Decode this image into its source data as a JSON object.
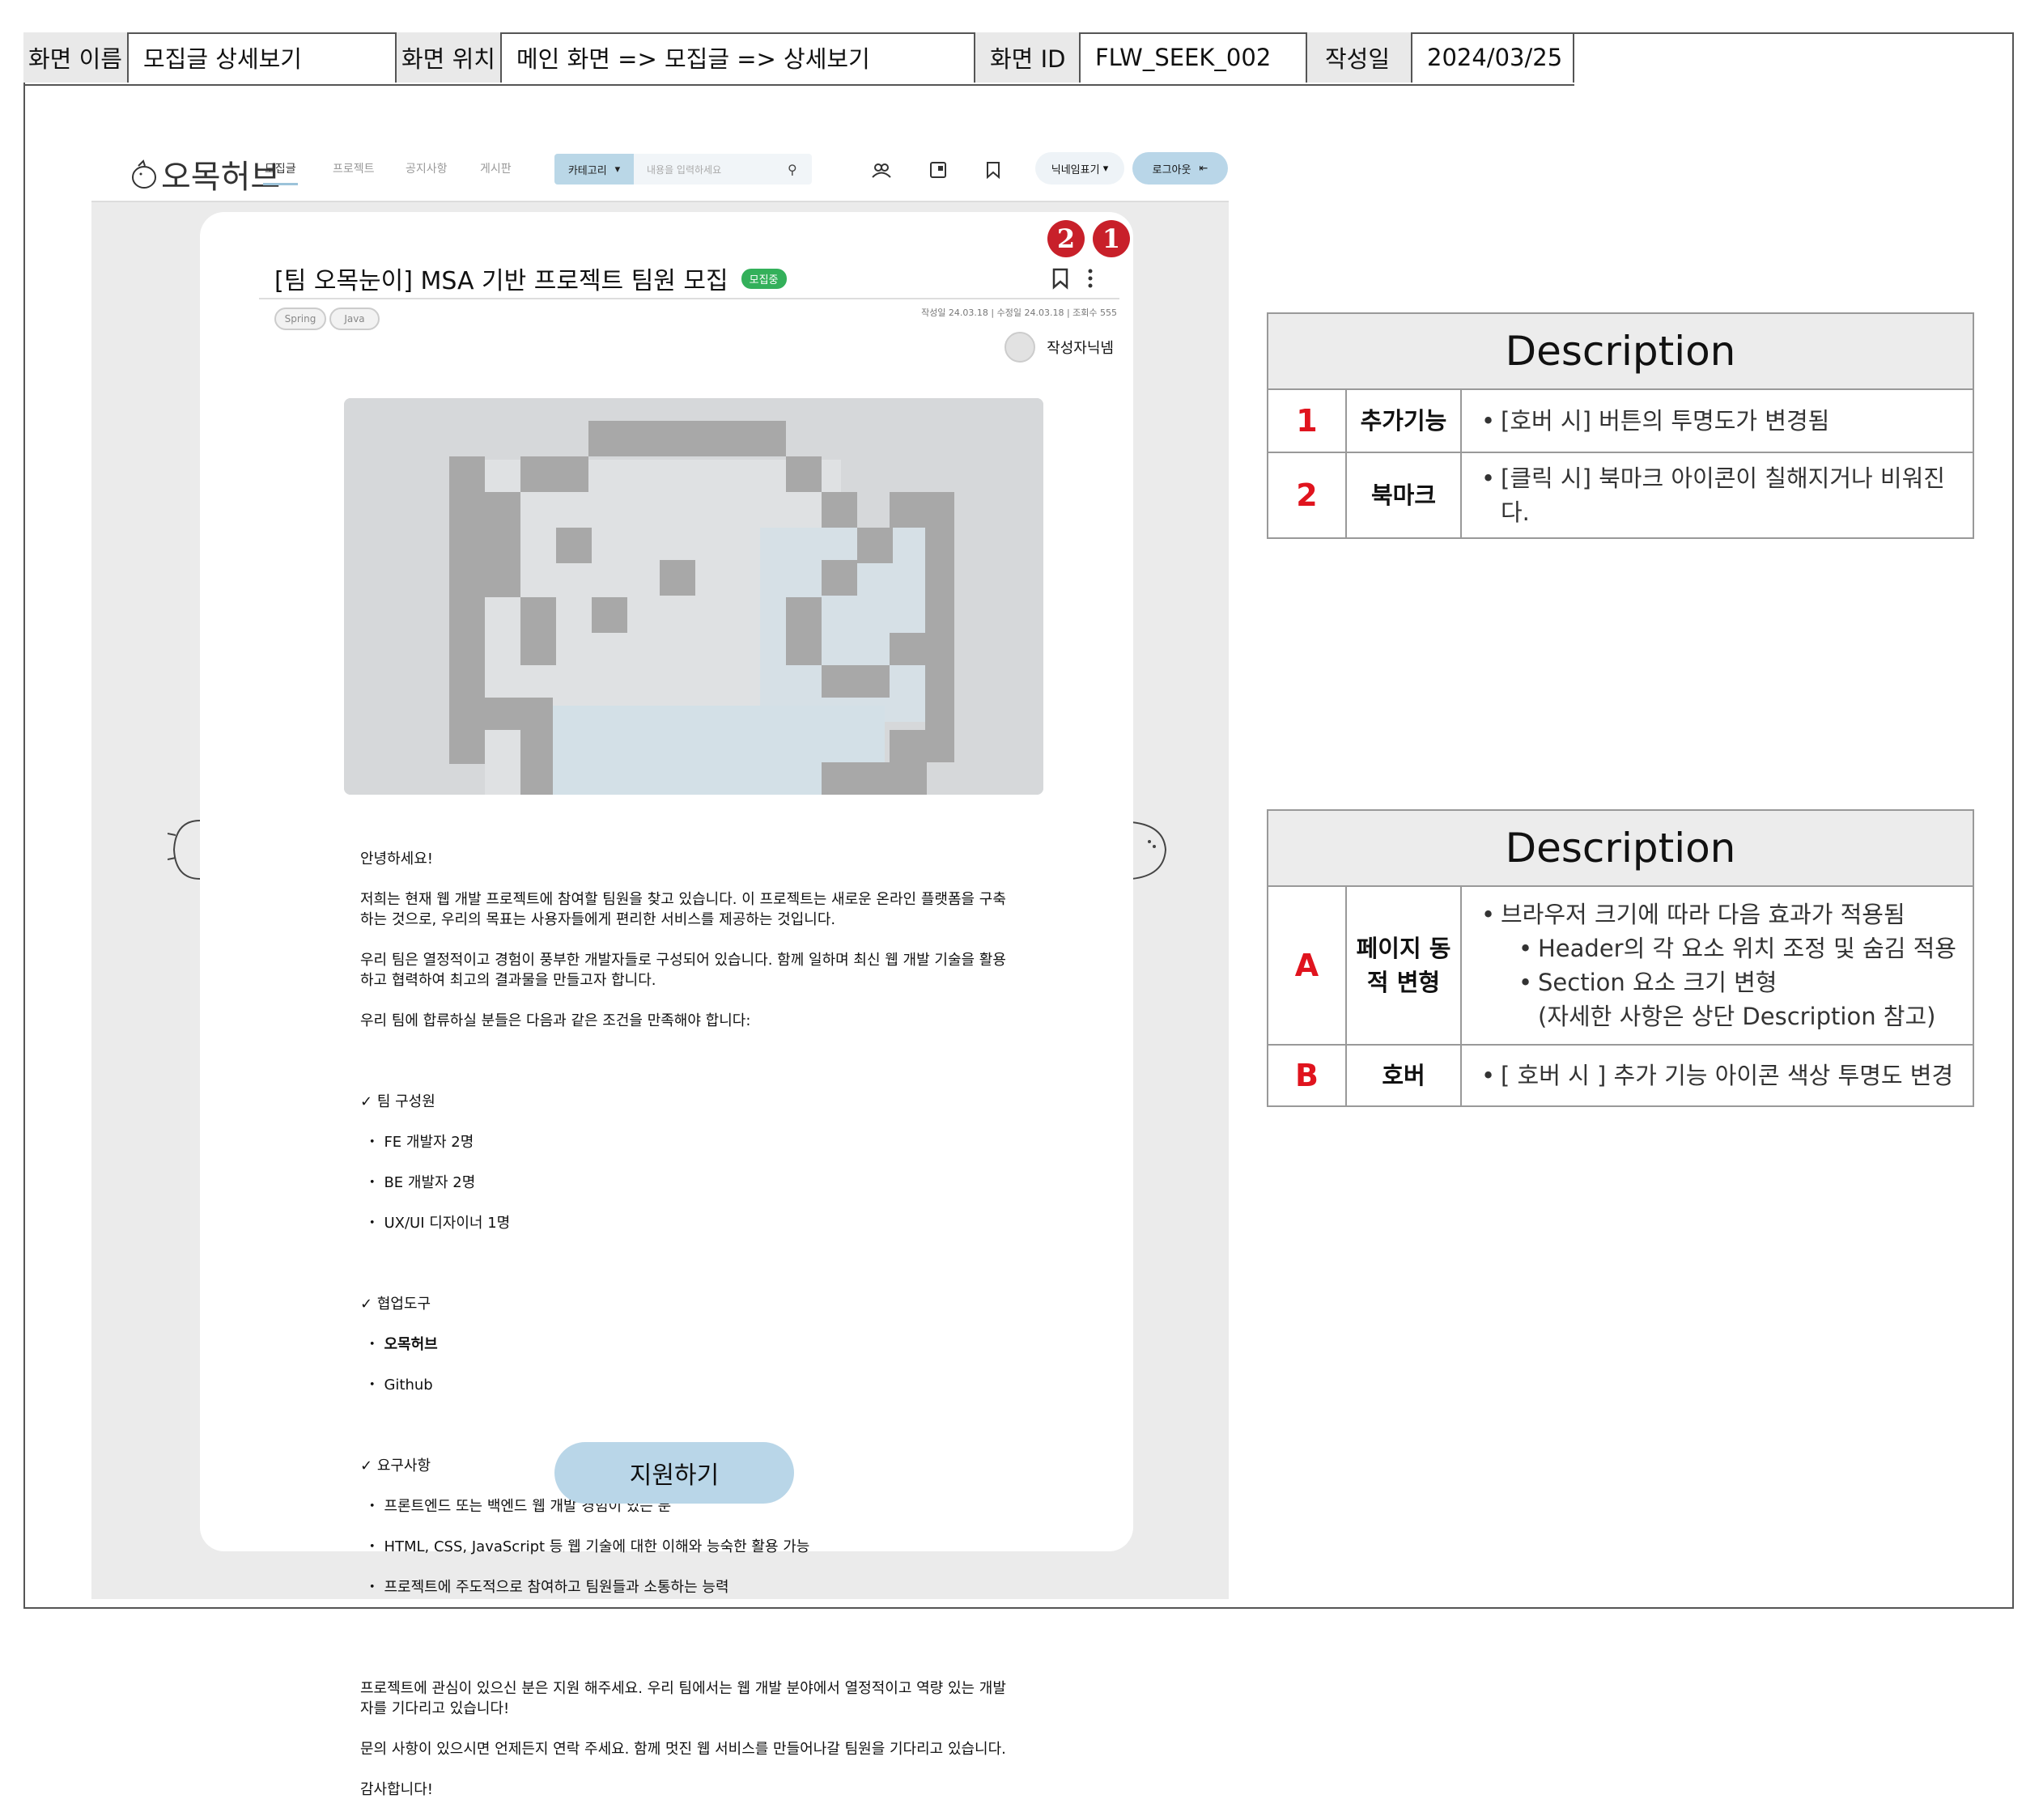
{
  "spec": {
    "screen_name_label": "화면 이름",
    "screen_name": "모집글 상세보기",
    "screen_loc_label": "화면 위치",
    "screen_loc": "메인 화면 => 모집글 => 상세보기",
    "screen_id_label": "화면 ID",
    "screen_id": "FLW_SEEK_002",
    "date_label": "작성일",
    "date": "2024/03/25"
  },
  "header": {
    "logo_text": "오목허브",
    "nav": [
      "모집글",
      "프로젝트",
      "공지사항",
      "게시판"
    ],
    "category": "카테고리",
    "search_placeholder": "내용을 입력하세요",
    "nickname": "닉네임표기",
    "logout": "로그아웃"
  },
  "post": {
    "title": "[팀 오목눈이] MSA 기반 프로젝트 팀원 모집",
    "status_badge": "모집중",
    "tags": [
      "Spring",
      "Java"
    ],
    "meta": "작성일 24.03.18 | 수정일 24.03.18 | 조회수 555",
    "author": "작성자닉넴",
    "body": {
      "greeting": "안녕하세요!",
      "intro": "저희는 현재 웹 개발 프로젝트에 참여할 팀원을 찾고 있습니다. 이 프로젝트는 새로운 온라인 플랫폼을 구축하는 것으로, 우리의 목표는 사용자들에게 편리한 서비스를 제공하는 것입니다.",
      "team_desc": "우리 팀은 열정적이고 경험이 풍부한 개발자들로 구성되어 있습니다. 함께 일하며 최신 웹 개발 기술을 활용하고 협력하여 최고의 결과물을 만들고자 합니다.",
      "condition": "우리 팀에 합류하실 분들은 다음과 같은 조건을 만족해야 합니다:",
      "members_title": "팀 구성원",
      "members": [
        "FE 개발자 2명",
        "BE 개발자 2명",
        "UX/UI 디자이너 1명"
      ],
      "tools_title": "협업도구",
      "tools": [
        "오목허브",
        "Github"
      ],
      "req_title": "요구사항",
      "reqs": [
        "프론트엔드 또는 백엔드 웹 개발 경험이 있는 분",
        "HTML, CSS, JavaScript 등 웹 기술에 대한 이해와 능숙한 활용 가능",
        "프로젝트에 주도적으로 참여하고 팀원들과 소통하는 능력"
      ],
      "closing1": "프로젝트에 관심이 있으신 분은 지원 해주세요. 우리 팀에서는 웹 개발 분야에서 열정적이고 역량 있는 개발자를 기다리고 있습니다!",
      "closing2": "문의 사항이 있으시면 언제든지 연락 주세요. 함께 멋진 웹 서비스를 만들어나갈 팀원을 기다리고 있습니다.",
      "thanks": "감사합니다!"
    },
    "apply_button": "지원하기"
  },
  "markers": [
    "1",
    "2"
  ],
  "desc1": {
    "title": "Description",
    "rows": [
      {
        "num": "1",
        "name": "추가기능",
        "text": "[호버 시]  버튼의 투명도가 변경됨"
      },
      {
        "num": "2",
        "name": "북마크",
        "text": "[클릭 시] 북마크 아이콘이 칠해지거나 비워진다."
      }
    ]
  },
  "desc2": {
    "title": "Description",
    "rows": [
      {
        "num": "A",
        "name": "페이지 동적 변형",
        "text": "브라우저 크기에 따라 다음 효과가 적용됨",
        "subs": [
          "Header의 각 요소 위치 조정 및 숨김 적용",
          "Section 요소 크기 변형",
          "(자세한 사항은 상단 Description 참고)"
        ]
      },
      {
        "num": "B",
        "name": "호버",
        "text": "[ 호버 시 ] 추가 기능 아이콘 색상 투명도 변경"
      }
    ]
  },
  "colors": {
    "accent": "#b9d6e8",
    "badge": "#33b05a",
    "marker": "#c8202a",
    "desc_num": "#e0141e"
  }
}
